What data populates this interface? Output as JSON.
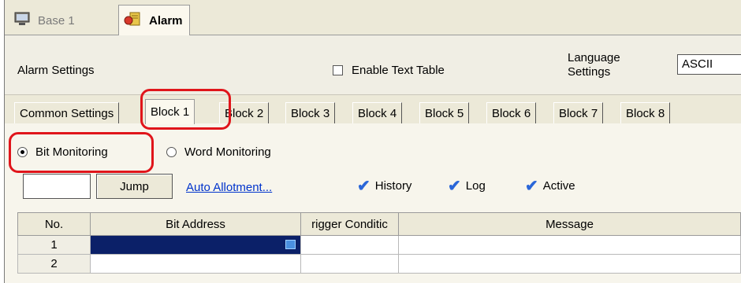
{
  "screen_tabs": [
    {
      "label": "Base 1",
      "icon": "screen-icon"
    },
    {
      "label": "Alarm",
      "icon": "alarm-icon"
    }
  ],
  "settings": {
    "title": "Alarm Settings",
    "enable_text_table": "Enable Text Table",
    "language_label_line1": "Language",
    "language_label_line2": "Settings",
    "language_value": "ASCII"
  },
  "block_tabs": [
    "Common Settings",
    "Block 1",
    "Block 2",
    "Block 3",
    "Block 4",
    "Block 5",
    "Block 6",
    "Block 7",
    "Block 8"
  ],
  "monitoring": {
    "bit": "Bit Monitoring",
    "word": "Word Monitoring"
  },
  "controls": {
    "jump": "Jump",
    "auto_allotment": "Auto Allotment...",
    "history": "History",
    "log": "Log",
    "active": "Active"
  },
  "table": {
    "headers": [
      "No.",
      "Bit Address",
      "rigger Conditic",
      "Message"
    ],
    "rows": [
      {
        "no": "1"
      },
      {
        "no": "2"
      }
    ]
  },
  "colors": {
    "highlight": "#e0151b",
    "selected_cell": "#0b2068",
    "link": "#0033cc",
    "check": "#2a66d8"
  }
}
